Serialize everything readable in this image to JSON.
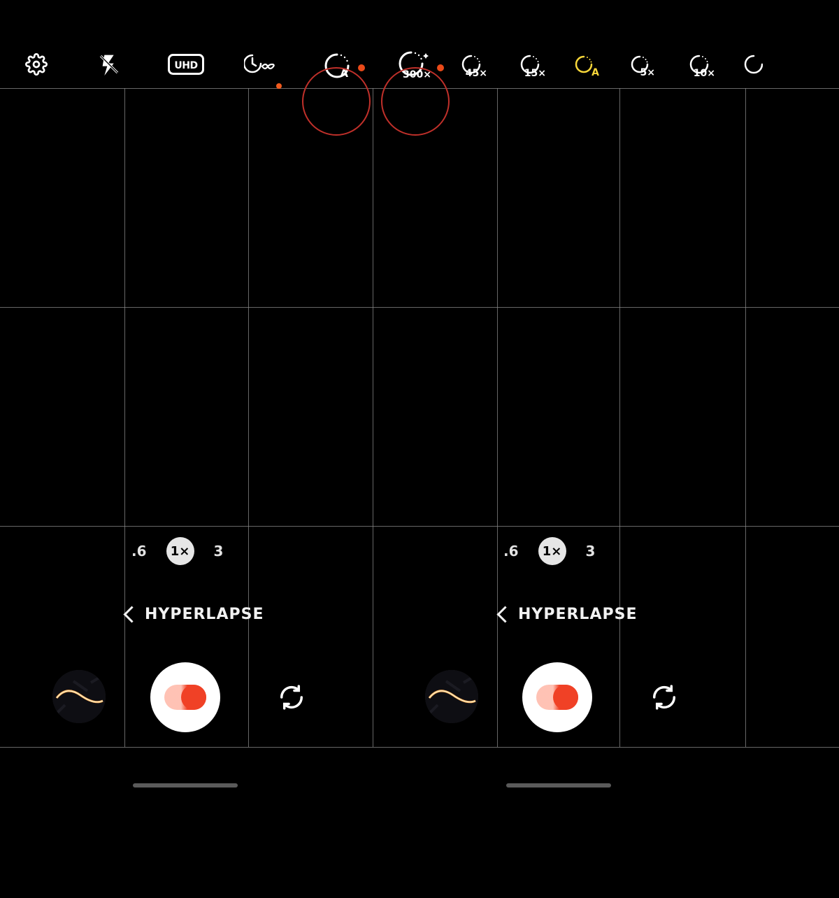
{
  "colors": {
    "accent": "#f8d73a",
    "red": "#c0302a",
    "orange": "#f04126"
  },
  "toolbar": {
    "left": {
      "settings": "settings-icon",
      "flash": "flash-off-icon",
      "quality": "UHD",
      "duration": "duration-infinity-icon",
      "speed": {
        "label": "A",
        "highlighted": true
      }
    },
    "right": {
      "nightSpeed": {
        "value": "300×",
        "star": true,
        "highlighted": true
      },
      "speeds": [
        "45×",
        "15×",
        "A",
        "5×",
        "10×"
      ],
      "selected": "A"
    }
  },
  "panes": {
    "left": {
      "zoom": {
        "options": [
          ".6",
          "1×",
          "3"
        ],
        "selected": "1×"
      },
      "mode": "HYPERLAPSE"
    },
    "right": {
      "zoom": {
        "options": [
          ".6",
          "1×",
          "3"
        ],
        "selected": "1×"
      },
      "mode": "HYPERLAPSE"
    }
  }
}
